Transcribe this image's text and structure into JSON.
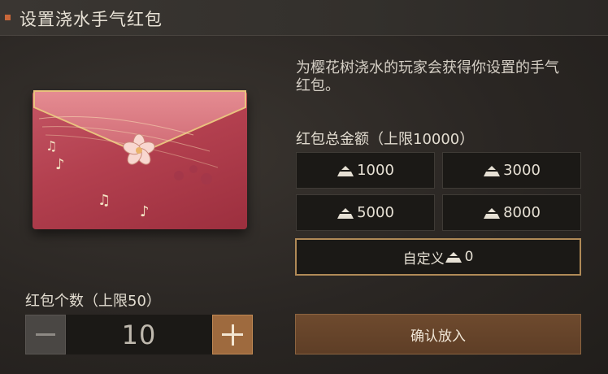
{
  "header": {
    "title": "设置浇水手气红包"
  },
  "description": "为樱花树浇水的玩家会获得你设置的手气红包。",
  "amount": {
    "label": "红包总金额（上限10000）",
    "options": [
      "1000",
      "3000",
      "5000",
      "8000"
    ],
    "custom_label": "自定义",
    "custom_value": "0"
  },
  "count": {
    "label": "红包个数（上限50）",
    "value": "10"
  },
  "confirm_label": "确认放入",
  "icons": {
    "currency": "silver-ingot-icon",
    "minus": "minus-icon",
    "plus": "plus-icon",
    "envelope": "red-envelope-illustration"
  },
  "colors": {
    "accent": "#c9673a",
    "envelope": "#b3404f",
    "custom_border": "#b08a57",
    "confirm_bg": "#6e4a2e",
    "plus_bg": "#9e6a3e"
  }
}
